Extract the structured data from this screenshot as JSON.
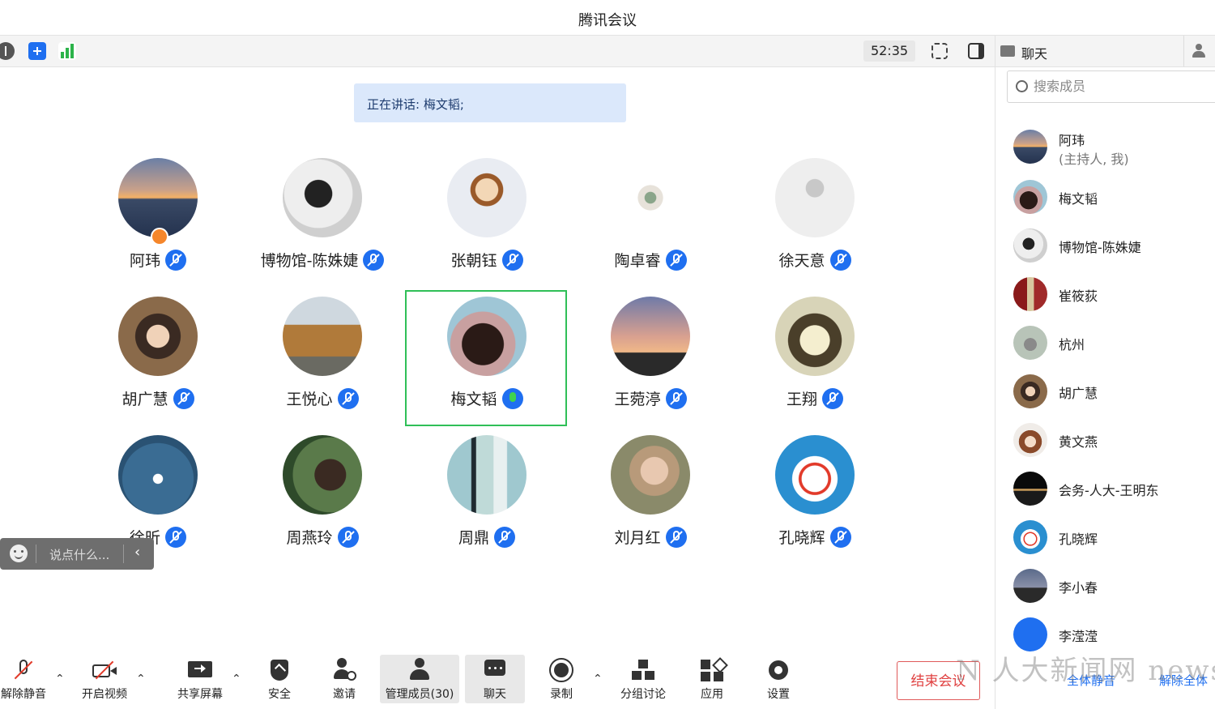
{
  "app": {
    "title": "腾讯会议"
  },
  "topbar": {
    "timer": "52:35"
  },
  "speaking": {
    "text": "正在讲话: 梅文韬;"
  },
  "participants": [
    {
      "name": "阿玮",
      "mic": "muted",
      "host": true
    },
    {
      "name": "博物馆-陈姝婕",
      "mic": "muted"
    },
    {
      "name": "张朝钰",
      "mic": "muted"
    },
    {
      "name": "陶卓睿",
      "mic": "muted"
    },
    {
      "name": "徐天意",
      "mic": "muted"
    },
    {
      "name": "胡广慧",
      "mic": "muted"
    },
    {
      "name": "王悦心",
      "mic": "muted"
    },
    {
      "name": "梅文韬",
      "mic": "active"
    },
    {
      "name": "王菀渟",
      "mic": "muted"
    },
    {
      "name": "王翔",
      "mic": "muted"
    },
    {
      "name": "徐昕",
      "mic": "muted"
    },
    {
      "name": "周燕玲",
      "mic": "muted"
    },
    {
      "name": "周鼎",
      "mic": "muted"
    },
    {
      "name": "刘月红",
      "mic": "muted"
    },
    {
      "name": "孔晓辉",
      "mic": "muted"
    }
  ],
  "chat_input": {
    "placeholder": "说点什么..."
  },
  "bottombar": {
    "unmute": "解除静音",
    "video": "开启视频",
    "share": "共享屏幕",
    "security": "安全",
    "invite": "邀请",
    "manage": "管理成员(30)",
    "chat": "聊天",
    "record": "录制",
    "breakout": "分组讨论",
    "apps": "应用",
    "settings": "设置",
    "end": "结束会议"
  },
  "panel": {
    "tab_chat": "聊天",
    "search_placeholder": "搜索成员",
    "members": [
      {
        "name": "阿玮",
        "sub": "(主持人, 我)"
      },
      {
        "name": "梅文韬"
      },
      {
        "name": "博物馆-陈姝婕"
      },
      {
        "name": "崔筱荻"
      },
      {
        "name": "杭州"
      },
      {
        "name": "胡广慧"
      },
      {
        "name": "黄文燕"
      },
      {
        "name": "会务-人大-王明东"
      },
      {
        "name": "孔晓辉"
      },
      {
        "name": "李小春"
      },
      {
        "name": "李滢滢"
      }
    ],
    "mute_all": "全体静音",
    "unmute_all": "解除全体"
  },
  "watermark": "N 人大新闻网 news.ruc.edu.cn",
  "colors": {
    "accent": "#1f6ff0",
    "active_frame": "#2fbf57",
    "end": "#e04040"
  }
}
